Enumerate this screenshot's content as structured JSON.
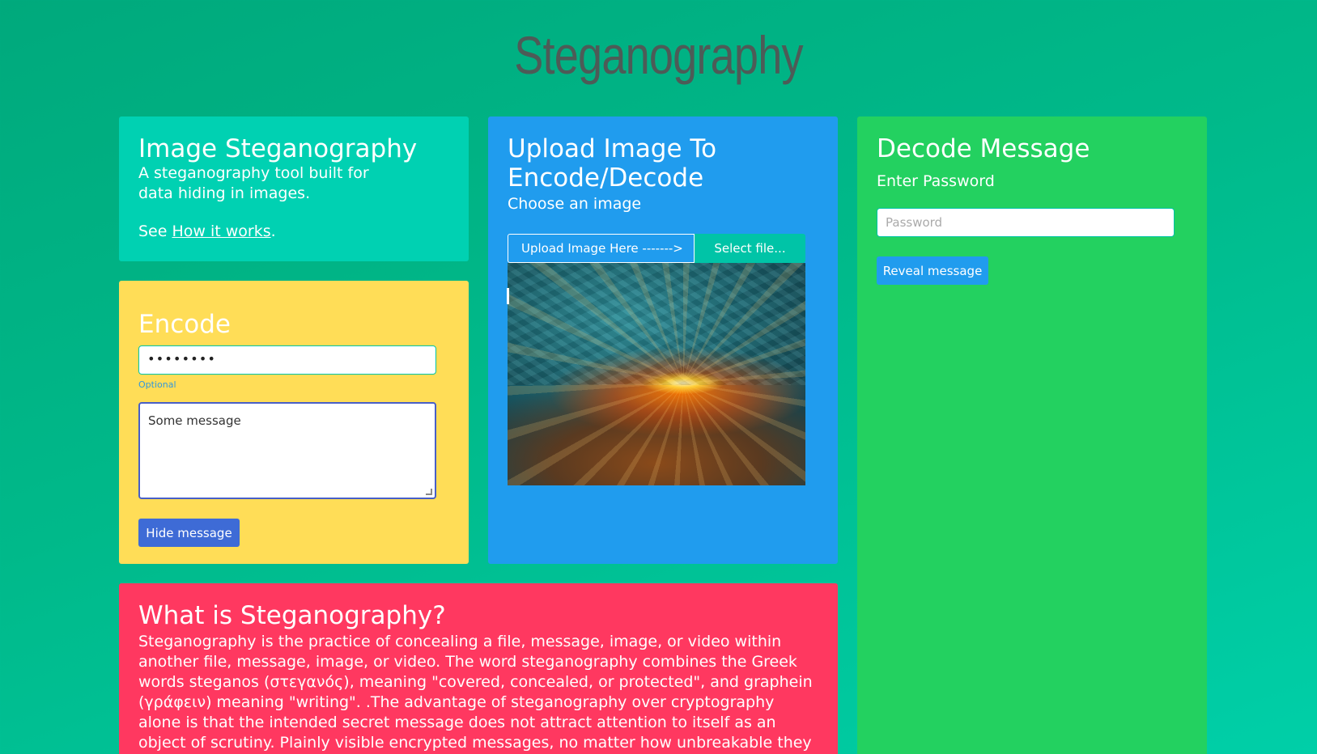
{
  "page": {
    "title": "Steganography"
  },
  "intro": {
    "title": "Image Steganography",
    "subtitle": "A steganography tool built for data hiding in images.",
    "see_prefix": "See ",
    "link_text": "How it works",
    "see_suffix": "."
  },
  "encode": {
    "title": "Encode",
    "password_value": "••••••••",
    "help_text": "Optional",
    "message_value": "Some message",
    "button_label": "Hide message"
  },
  "upload": {
    "title": "Upload Image To Encode/Decode",
    "subtitle": "Choose an image",
    "upload_label": "Upload Image Here ------->",
    "select_label": "Select file..."
  },
  "decode": {
    "title": "Decode Message",
    "password_label": "Enter Password",
    "password_placeholder": "Password",
    "button_label": "Reveal message"
  },
  "whatis": {
    "title": "What is Steganography?",
    "body": "Steganography is the practice of concealing a file, message, image, or video within another file, message, image, or video. The word steganography combines the Greek words steganos (στεγανός), meaning \"covered, concealed, or protected\", and graphein (γράφειν) meaning \"writing\". .The advantage of steganography over cryptography alone is that the intended secret message does not attract attention to itself as an object of scrutiny. Plainly visible encrypted messages, no matter how unbreakable they are, arouse interest and may in"
  },
  "colors": {
    "intro": "#00d1b2",
    "encode": "#ffdd57",
    "upload": "#209cee",
    "decode": "#23d160",
    "whatis": "#ff3860",
    "hide_button": "#3e6bd6",
    "reveal_button": "#209cee"
  }
}
